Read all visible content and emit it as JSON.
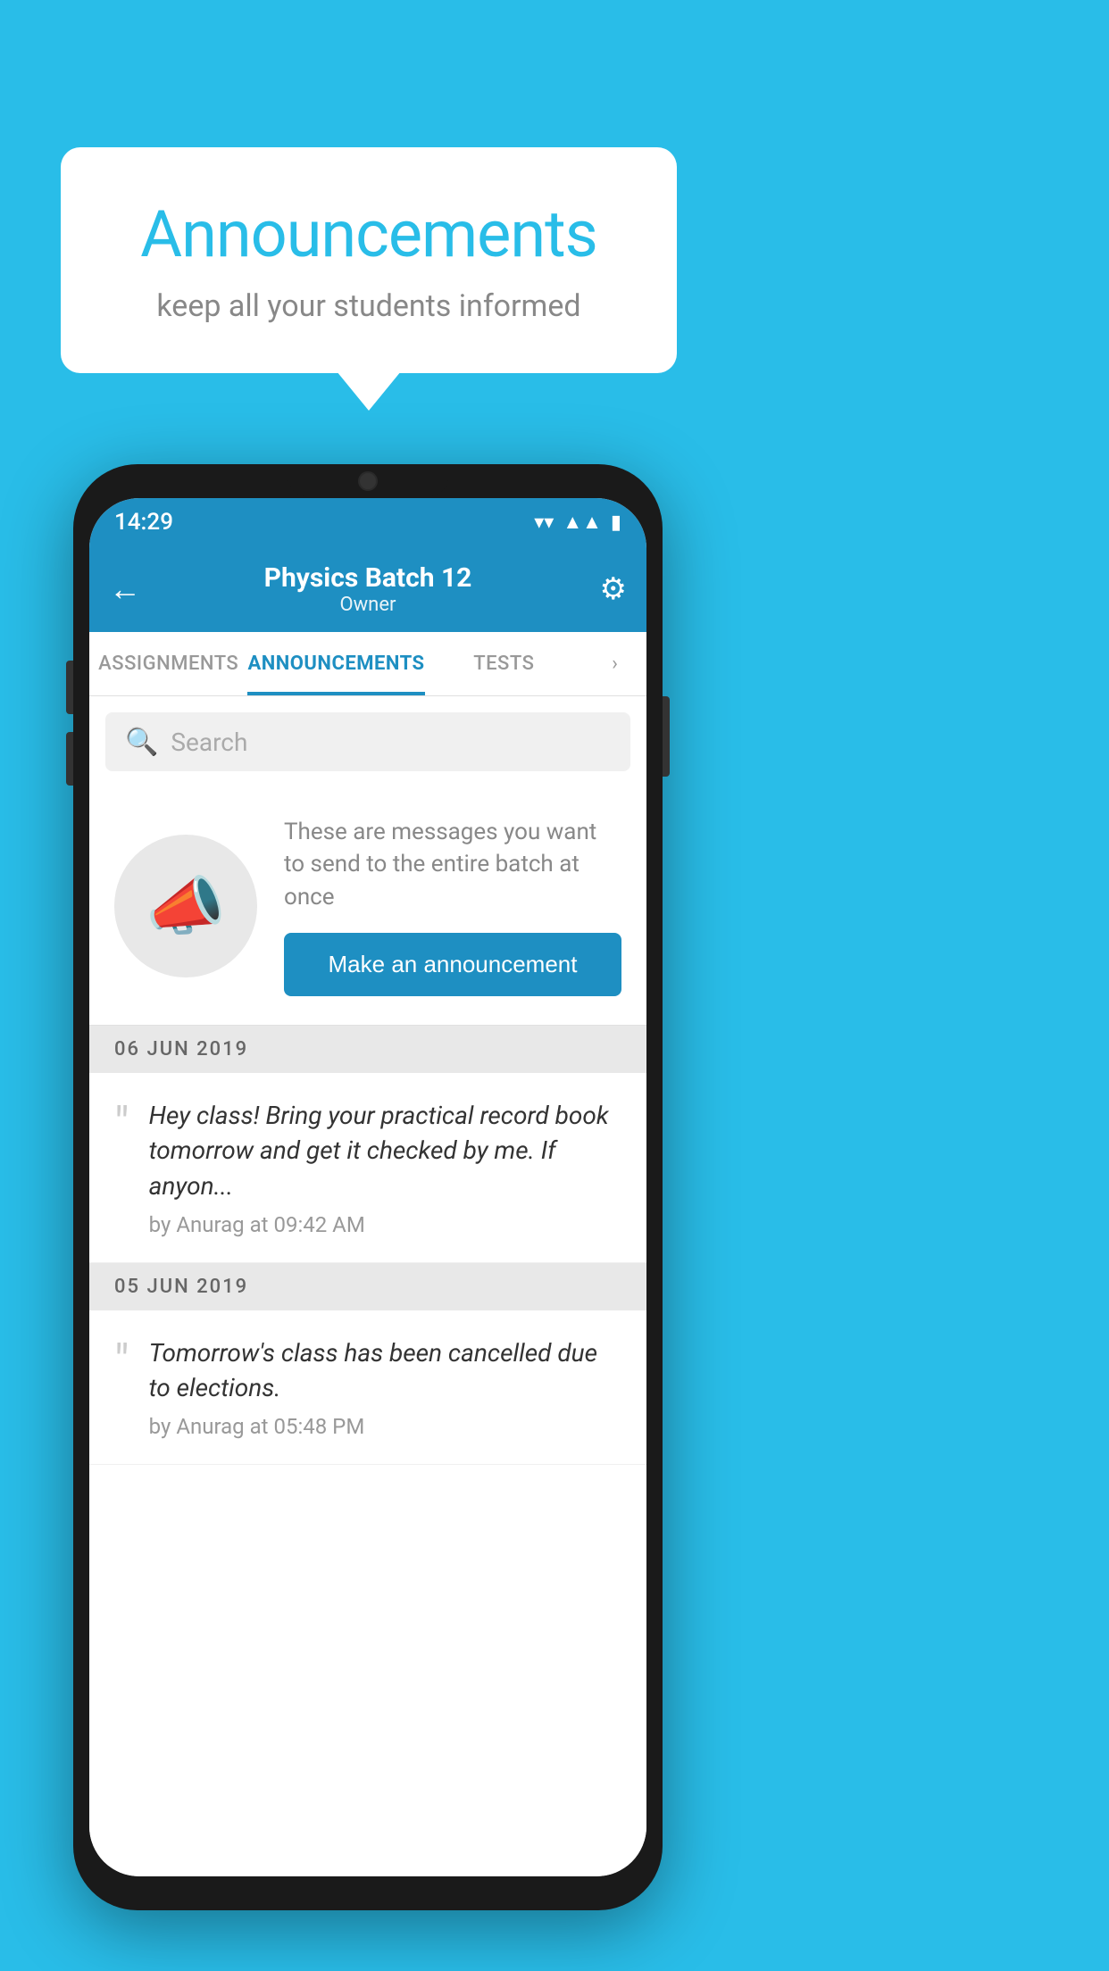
{
  "background_color": "#29bde8",
  "bubble": {
    "title": "Announcements",
    "subtitle": "keep all your students informed"
  },
  "phone": {
    "status_bar": {
      "time": "14:29"
    },
    "app_bar": {
      "title": "Physics Batch 12",
      "subtitle": "Owner",
      "back_label": "←",
      "settings_label": "⚙"
    },
    "tabs": [
      {
        "label": "ASSIGNMENTS",
        "active": false
      },
      {
        "label": "ANNOUNCEMENTS",
        "active": true
      },
      {
        "label": "TESTS",
        "active": false
      }
    ],
    "search": {
      "placeholder": "Search"
    },
    "announcement_prompt": {
      "description": "These are messages you want to send to the entire batch at once",
      "button_label": "Make an announcement"
    },
    "announcement_groups": [
      {
        "date": "06  JUN  2019",
        "items": [
          {
            "message": "Hey class! Bring your practical record book tomorrow and get it checked by me. If anyon...",
            "meta": "by Anurag at 09:42 AM"
          }
        ]
      },
      {
        "date": "05  JUN  2019",
        "items": [
          {
            "message": "Tomorrow's class has been cancelled due to elections.",
            "meta": "by Anurag at 05:48 PM"
          }
        ]
      }
    ]
  }
}
